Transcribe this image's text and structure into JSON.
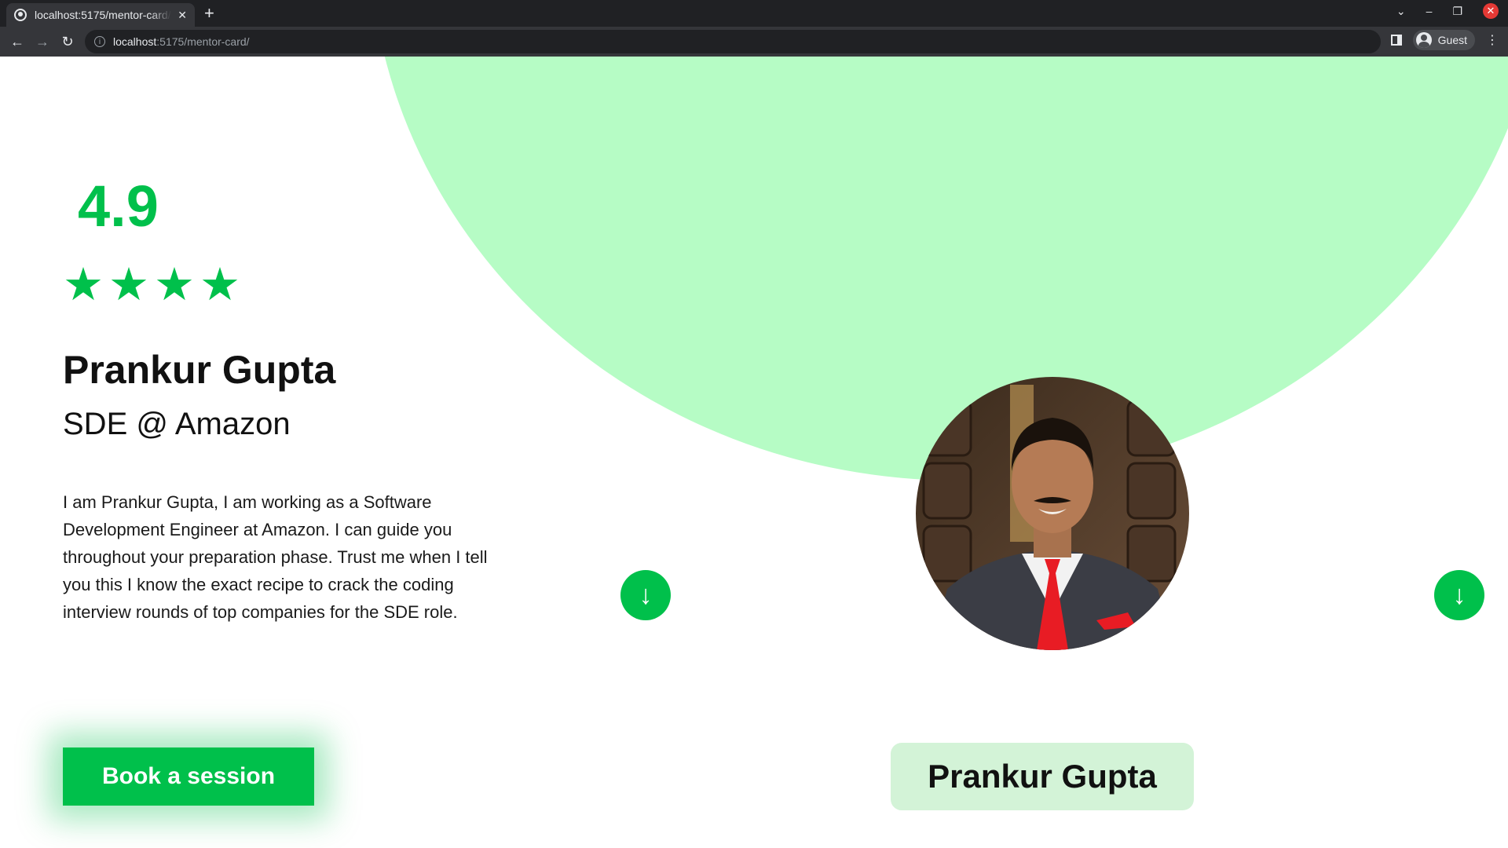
{
  "browser": {
    "tab_title": "localhost:5175/mentor-card/",
    "tab_close": "✕",
    "new_tab": "+",
    "url_host": "localhost",
    "url_path": ":5175/mentor-card/",
    "profile_label": "Guest",
    "controls": {
      "dropdown": "⌄",
      "minimize": "–",
      "restore": "❐",
      "close": "✕"
    },
    "nav": {
      "back": "←",
      "forward": "→",
      "reload": "↻"
    },
    "info": "i",
    "menu": "⋮"
  },
  "mentor": {
    "rating": "4.9",
    "stars": [
      "★",
      "★",
      "★",
      "★"
    ],
    "name": "Prankur Gupta",
    "role": "SDE @ Amazon",
    "bio": "I am Prankur Gupta, I am working as a Software Development Engineer at Amazon. I can guide you throughout your preparation phase. Trust me when I tell you this I know the exact recipe to crack the coding interview rounds of top companies for the SDE role.",
    "book_label": "Book a session",
    "card_name": "Prankur Gupta"
  },
  "carousel": {
    "prev_arrow": "↓",
    "next_arrow": "↓"
  },
  "colors": {
    "accent": "#00c04b",
    "blob": "#b6fcc5",
    "name_card_bg": "#d3f3d7"
  }
}
